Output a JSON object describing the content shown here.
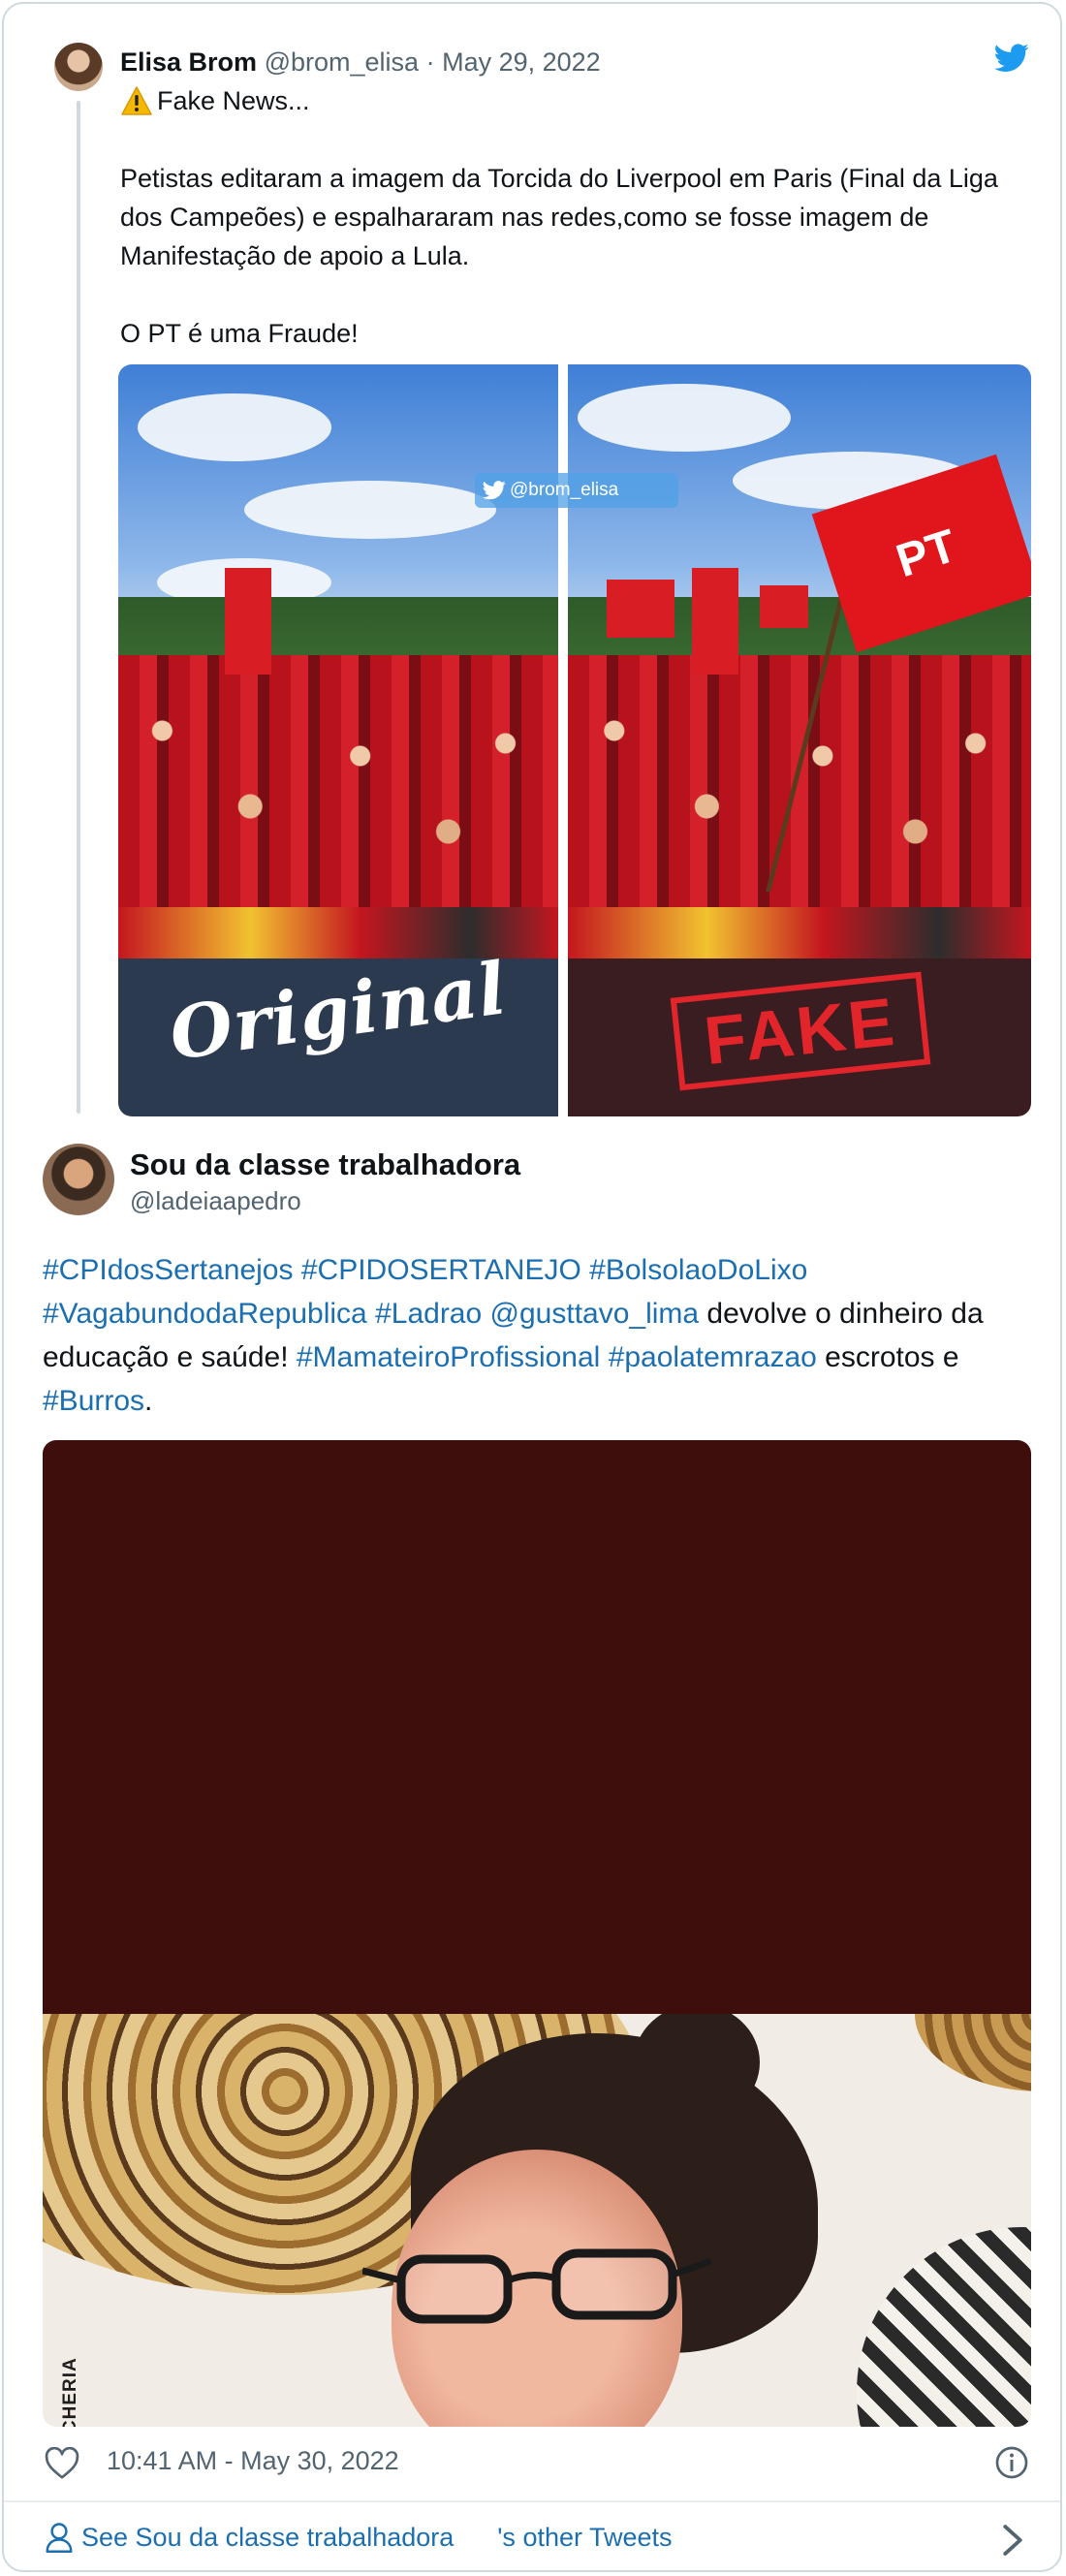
{
  "quoted_tweet": {
    "name": "Elisa Brom",
    "handle": "@brom_elisa",
    "separator": "·",
    "date": "May 29, 2022",
    "line1": "Fake News...",
    "paragraph2": "Petistas editaram a imagem da Torcida do Liverpool em Paris (Final da Liga dos Campeões) e espalhararam nas redes,como se fosse imagem de Manifestação de apoio a Lula.",
    "paragraph3": "O PT é uma Fraude!",
    "media": {
      "watermark": "@brom_elisa",
      "left_label": "Original",
      "right_label": "FAKE",
      "flag_text": "PT"
    }
  },
  "tweet": {
    "name": "Sou da classe trabalhadora",
    "handle": "@ladeiaapedro",
    "text_parts": {
      "h1": "#CPIdosSertanejos",
      "h2": "#CPIDOSERTANEJO",
      "h3": "#BolsolaoDoLixo",
      "h4": "#VagabundodaRepublica",
      "h5": "#Ladrao",
      "mention": "@gusttavo_lima",
      "t1": " devolve o dinheiro da educação e saúde! ",
      "h6": "#MamateiroProfissional",
      "h7": "#paolatemrazao",
      "t2": " escrotos e ",
      "h8": "#Burros",
      "t3": "."
    },
    "media": {
      "brand": "DEBOCHERIA"
    },
    "timestamp": "10:41 AM - May 30, 2022"
  },
  "footer": {
    "see_label": "See Sou da classe trabalhadora",
    "other_tweets": "'s other Tweets"
  },
  "colors": {
    "link": "#1b6fb0",
    "twitter_blue": "#1d9bf0",
    "muted": "#536471",
    "border": "#cfd9de",
    "dark_block": "#3d0e0c"
  },
  "icons": [
    "twitter-bird-icon",
    "warning-icon",
    "heart-icon",
    "info-icon",
    "person-icon",
    "chevron-right-icon"
  ]
}
